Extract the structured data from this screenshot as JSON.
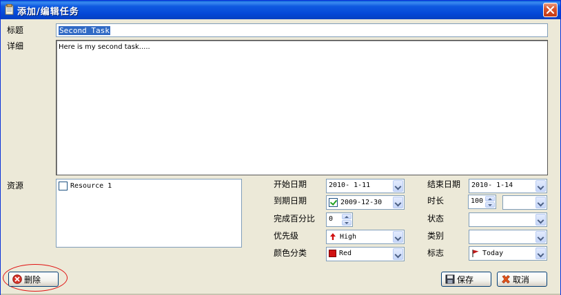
{
  "window": {
    "title": "添加/编辑任务"
  },
  "fields": {
    "title_label": "标题",
    "title_value": "Second Task",
    "detail_label": "详细",
    "detail_value": "Here is my second task.....",
    "resource_label": "资源",
    "resources": [
      {
        "label": "Resource 1",
        "checked": false
      }
    ],
    "start_date_label": "开始日期",
    "start_date_value": "2010- 1-11",
    "end_date_label": "结束日期",
    "end_date_value": "2010- 1-14",
    "due_date_label": "到期日期",
    "due_date_value": "2009-12-30",
    "due_date_checked": true,
    "duration_label": "时长",
    "duration_value": "100",
    "duration_unit_value": "",
    "percent_label": "完成百分比",
    "percent_value": "0",
    "status_label": "状态",
    "status_value": "",
    "priority_label": "优先级",
    "priority_value": "High",
    "category_label": "类别",
    "category_value": "",
    "color_label": "颜色分类",
    "color_value": "Red",
    "flag_label": "标志",
    "flag_value": "Today"
  },
  "buttons": {
    "delete_label": "删除",
    "save_label": "保存",
    "cancel_label": "取消"
  },
  "icons": {
    "window": "notepad-icon",
    "close": "close-icon",
    "priority": "arrow-up-icon",
    "color": "red-square-icon",
    "flag": "flag-icon",
    "delete": "delete-icon",
    "save": "floppy-disk-icon",
    "cancel": "cancel-x-icon"
  },
  "colors": {
    "titlebar": "#0548D8",
    "selection": "#316AC5",
    "priority_arrow": "#D01010",
    "color_category": "#D01010",
    "flag": "#C01818",
    "highlight_oval": "#E01010"
  }
}
